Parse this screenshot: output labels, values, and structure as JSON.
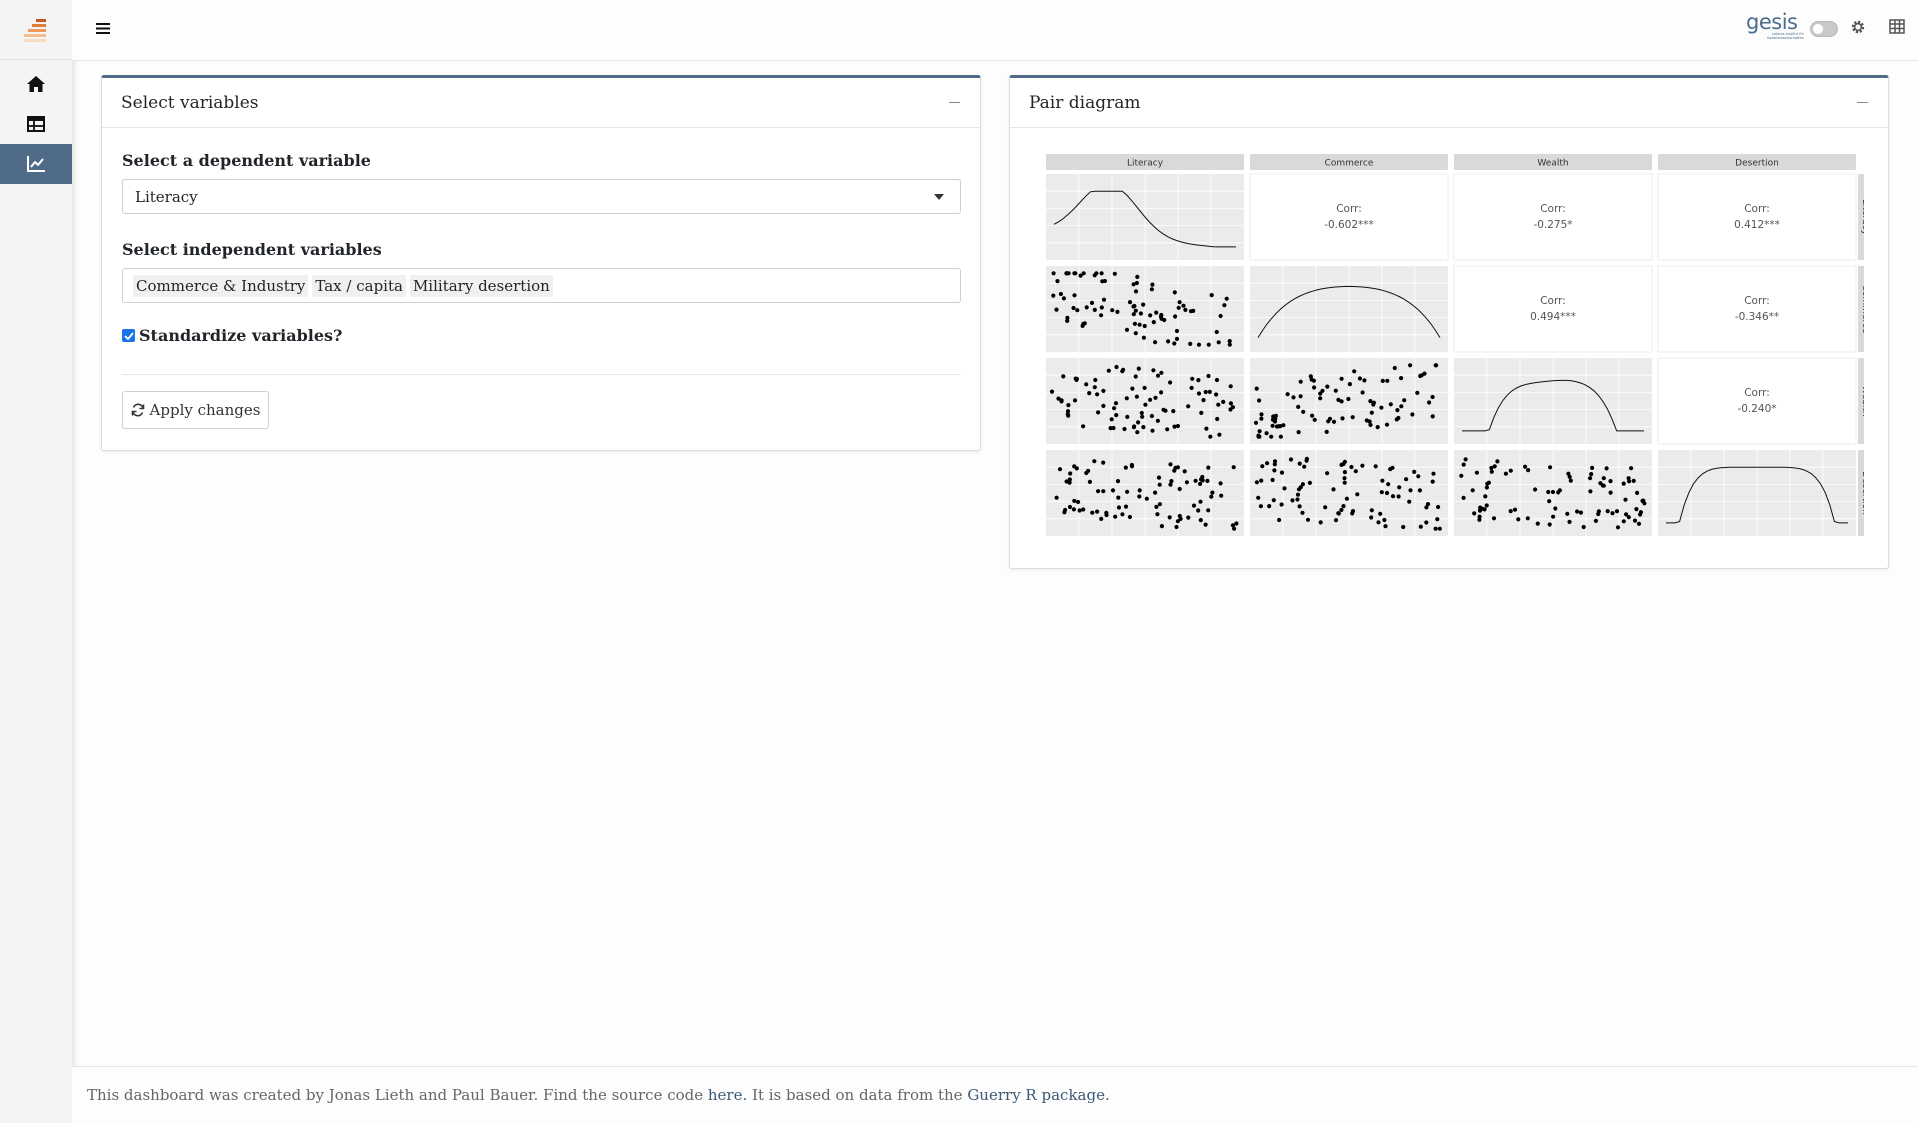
{
  "topbar": {
    "logo_word": "gesis",
    "logo_sub": "Leibniz-Institut für Sozialwissenschaften"
  },
  "select_card": {
    "title": "Select variables",
    "dependent_label": "Select a dependent variable",
    "dependent_value": "Literacy",
    "independent_label": "Select independent variables",
    "independent_values": [
      "Commerce & Industry",
      "Tax / capita",
      "Military desertion"
    ],
    "standardize_label": "Standardize variables?",
    "standardize_checked": true,
    "apply_label": "Apply changes"
  },
  "pair_card": {
    "title": "Pair diagram"
  },
  "chart_data": {
    "type": "scatter",
    "variables": [
      "Literacy",
      "Commerce",
      "Wealth",
      "Desertion"
    ],
    "correlations": [
      {
        "row": "Literacy",
        "col": "Commerce",
        "label": "Corr:",
        "value": "-0.602***"
      },
      {
        "row": "Literacy",
        "col": "Wealth",
        "label": "Corr:",
        "value": "-0.275*"
      },
      {
        "row": "Literacy",
        "col": "Desertion",
        "label": "Corr:",
        "value": "0.412***"
      },
      {
        "row": "Commerce",
        "col": "Wealth",
        "label": "Corr:",
        "value": "0.494***"
      },
      {
        "row": "Commerce",
        "col": "Desertion",
        "label": "Corr:",
        "value": "-0.346**"
      },
      {
        "row": "Wealth",
        "col": "Desertion",
        "label": "Corr:",
        "value": "-0.240*"
      }
    ],
    "grid": true
  },
  "footer": {
    "text_1": "This dashboard was created by Jonas Lieth and Paul Bauer. Find the source code ",
    "link_1": "here.",
    "text_2": " It is based on data from the ",
    "link_2": "Guerry R package."
  },
  "colors": {
    "accent": "#4f6b87",
    "brand": "#e07b39"
  }
}
